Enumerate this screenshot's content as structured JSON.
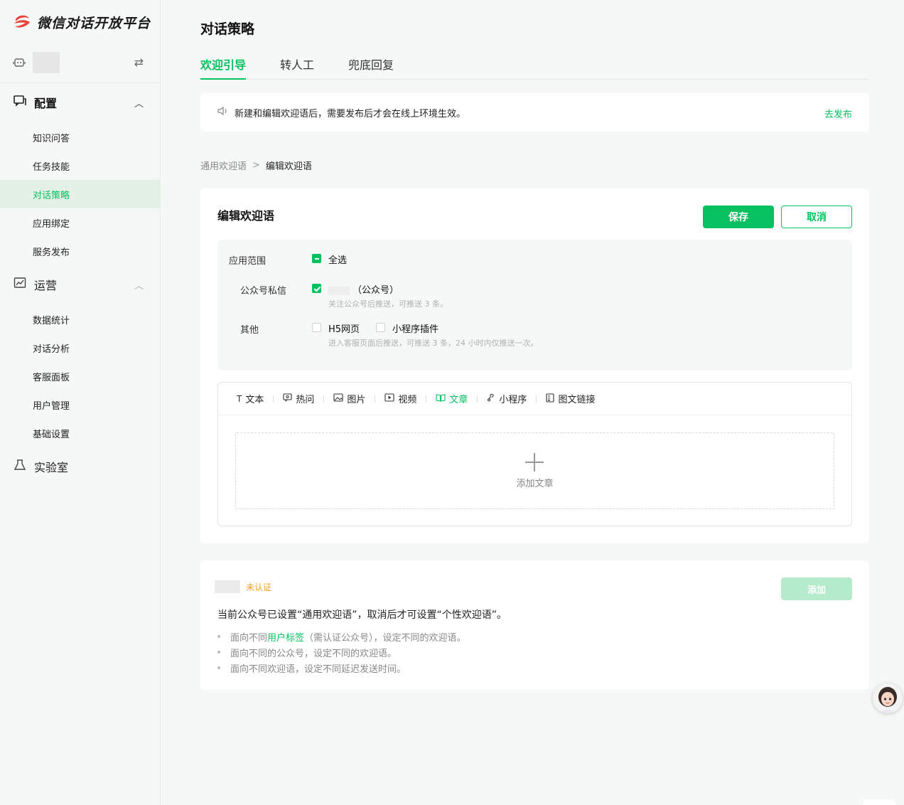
{
  "app": {
    "name": "微信对话开放平台"
  },
  "sidebar": {
    "groups": [
      {
        "label": "配置",
        "icon": "chat-config-icon",
        "items": [
          "知识问答",
          "任务技能",
          "对话策略",
          "应用绑定",
          "服务发布"
        ]
      },
      {
        "label": "运营",
        "icon": "chart-icon",
        "items": [
          "数据统计",
          "对话分析",
          "客服面板",
          "用户管理",
          "基础设置"
        ]
      },
      {
        "label": "实验室",
        "icon": "flask-icon"
      }
    ],
    "active_item": "对话策略"
  },
  "page": {
    "title": "对话策略"
  },
  "tabs": [
    {
      "label": "欢迎引导",
      "active": true
    },
    {
      "label": "转人工",
      "active": false
    },
    {
      "label": "兜底回复",
      "active": false
    }
  ],
  "notice": {
    "text": "新建和编辑欢迎语后，需要发布后才会在线上环境生效。",
    "link": "去发布"
  },
  "breadcrumb": {
    "parent": "通用欢迎语",
    "separator": ">",
    "current": "编辑欢迎语"
  },
  "editor_card": {
    "title": "编辑欢迎语",
    "save_label": "保存",
    "cancel_label": "取消",
    "scope": {
      "label": "应用范围",
      "select_all": "全选",
      "select_all_state": "partial",
      "official": {
        "label": "公众号私信",
        "option": "（公众号）",
        "checked": true,
        "hint": "关注公众号后推送，可推送 3 条。"
      },
      "other": {
        "label": "其他",
        "options": [
          {
            "label": "H5网页",
            "checked": false
          },
          {
            "label": "小程序插件",
            "checked": false
          }
        ],
        "hint": "进入客服页面后推送，可推送 3 条，24 小时内仅推送一次。"
      }
    },
    "toolbar": [
      {
        "label": "文本",
        "icon": "text-icon",
        "active": false
      },
      {
        "label": "热问",
        "icon": "hot-question-icon",
        "active": false
      },
      {
        "label": "图片",
        "icon": "image-icon",
        "active": false
      },
      {
        "label": "视频",
        "icon": "video-icon",
        "active": false
      },
      {
        "label": "文章",
        "icon": "article-icon",
        "active": true
      },
      {
        "label": "小程序",
        "icon": "miniprogram-icon",
        "active": false
      },
      {
        "label": "图文链接",
        "icon": "link-card-icon",
        "active": false
      }
    ],
    "add_label": "添加文章"
  },
  "personal_card": {
    "status": "未认证",
    "add_label": "添加",
    "info": "当前公众号已设置“通用欢迎语”，取消后才可设置“个性欢迎语”。",
    "bullets": [
      {
        "pre": "面向不同",
        "link": "用户标签",
        "post": "（需认证公众号），设定不同的欢迎语。"
      },
      {
        "pre": "面向不同的公众号，设定不同的欢迎语。",
        "link": "",
        "post": ""
      },
      {
        "pre": "面向不同欢迎语，设定不同延迟发送时间。",
        "link": "",
        "post": ""
      }
    ]
  },
  "colors": {
    "brand": "#07c160",
    "warning": "#f0a020",
    "logo": "#e8443b"
  }
}
